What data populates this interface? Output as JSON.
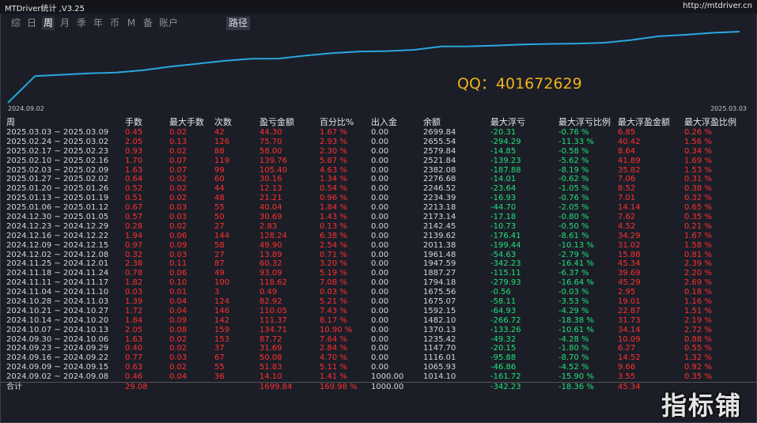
{
  "window": {
    "title": "MTDriver统计 ,V3.25",
    "link": "http://mtdriver.cn"
  },
  "tabs": [
    {
      "label": "综",
      "active": false
    },
    {
      "label": "日",
      "active": false
    },
    {
      "label": "周",
      "active": true
    },
    {
      "label": "月",
      "active": false
    },
    {
      "label": "季",
      "active": false
    },
    {
      "label": "年",
      "active": false
    },
    {
      "label": "币",
      "active": false
    },
    {
      "label": "M",
      "active": false
    },
    {
      "label": "备",
      "active": false
    },
    {
      "label": "账户",
      "active": false
    }
  ],
  "path_button": "路径",
  "chart": {
    "overlay_text": "QQ：401672629",
    "x_start_label": "2024.09.02",
    "x_end_label": "2025.03.03",
    "line_color": "#2aa7e0"
  },
  "columns": [
    "周",
    "手数",
    "最大手数",
    "次数",
    "盈亏金额",
    "百分比%",
    "出入金",
    "余额",
    "最大浮亏",
    "最大浮亏比例",
    "最大浮盈金额",
    "最大浮盈比例"
  ],
  "rows": [
    [
      "2025.03.03 ~ 2025.03.09",
      "0.45",
      "0.02",
      "42",
      "44.30",
      "1.67 %",
      "0.00",
      "2699.84",
      "-20.31",
      "-0.76 %",
      "6.85",
      "0.26 %"
    ],
    [
      "2025.02.24 ~ 2025.03.02",
      "2.05",
      "0.13",
      "126",
      "75.70",
      "2.93 %",
      "0.00",
      "2655.54",
      "-294.29",
      "-11.33 %",
      "40.42",
      "1.56 %"
    ],
    [
      "2025.02.17 ~ 2025.02.23",
      "0.93",
      "0.02",
      "88",
      "58.00",
      "2.30 %",
      "0.00",
      "2579.84",
      "-14.85",
      "-0.58 %",
      "8.64",
      "0.34 %"
    ],
    [
      "2025.02.10 ~ 2025.02.16",
      "1.70",
      "0.07",
      "119",
      "139.76",
      "5.87 %",
      "0.00",
      "2521.84",
      "-139.23",
      "-5.62 %",
      "41.89",
      "1.69 %"
    ],
    [
      "2025.02.03 ~ 2025.02.09",
      "1.63",
      "0.07",
      "99",
      "105.40",
      "4.63 %",
      "0.00",
      "2382.08",
      "-187.88",
      "-8.19 %",
      "35.82",
      "1.53 %"
    ],
    [
      "2025.01.27 ~ 2025.02.02",
      "0.64",
      "0.02",
      "60",
      "30.16",
      "1.34 %",
      "0.00",
      "2276.68",
      "-14.01",
      "-0.62 %",
      "7.06",
      "0.31 %"
    ],
    [
      "2025.01.20 ~ 2025.01.26",
      "0.52",
      "0.02",
      "44",
      "12.13",
      "0.54 %",
      "0.00",
      "2246.52",
      "-23.64",
      "-1.05 %",
      "8.52",
      "0.38 %"
    ],
    [
      "2025.01.13 ~ 2025.01.19",
      "0.51",
      "0.02",
      "48",
      "21.21",
      "0.96 %",
      "0.00",
      "2234.39",
      "-16.93",
      "-0.76 %",
      "7.01",
      "0.32 %"
    ],
    [
      "2025.01.06 ~ 2025.01.12",
      "0.67",
      "0.03",
      "55",
      "40.04",
      "1.84 %",
      "0.00",
      "2213.18",
      "-44.70",
      "-2.05 %",
      "14.14",
      "0.65 %"
    ],
    [
      "2024.12.30 ~ 2025.01.05",
      "0.57",
      "0.03",
      "50",
      "30.69",
      "1.43 %",
      "0.00",
      "2173.14",
      "-17.18",
      "-0.80 %",
      "7.62",
      "0.35 %"
    ],
    [
      "2024.12.23 ~ 2024.12.29",
      "0.28",
      "0.02",
      "27",
      "2.83",
      "0.13 %",
      "0.00",
      "2142.45",
      "-10.73",
      "-0.50 %",
      "4.52",
      "0.21 %"
    ],
    [
      "2024.12.16 ~ 2024.12.22",
      "1.94",
      "0.06",
      "144",
      "128.24",
      "6.38 %",
      "0.00",
      "2139.62",
      "-176.41",
      "-8.61 %",
      "34.29",
      "1.67 %"
    ],
    [
      "2024.12.09 ~ 2024.12.15",
      "0.97",
      "0.09",
      "58",
      "49.90",
      "2.54 %",
      "0.00",
      "2011.38",
      "-199.44",
      "-10.13 %",
      "31.02",
      "1.58 %"
    ],
    [
      "2024.12.02 ~ 2024.12.08",
      "0.32",
      "0.03",
      "27",
      "13.89",
      "0.71 %",
      "0.00",
      "1961.48",
      "-54.63",
      "-2.79 %",
      "15.88",
      "0.81 %"
    ],
    [
      "2024.11.25 ~ 2024.12.01",
      "2.38",
      "0.11",
      "87",
      "60.32",
      "3.20 %",
      "0.00",
      "1947.59",
      "-342.23",
      "-16.41 %",
      "45.34",
      "2.39 %"
    ],
    [
      "2024.11.18 ~ 2024.11.24",
      "0.78",
      "0.06",
      "49",
      "93.09",
      "5.19 %",
      "0.00",
      "1887.27",
      "-115.11",
      "-6.37 %",
      "39.69",
      "2.20 %"
    ],
    [
      "2024.11.11 ~ 2024.11.17",
      "1.82",
      "0.10",
      "100",
      "118.62",
      "7.08 %",
      "0.00",
      "1794.18",
      "-279.93",
      "-16.64 %",
      "45.29",
      "2.69 %"
    ],
    [
      "2024.11.04 ~ 2024.11.10",
      "0.03",
      "0.01",
      "3",
      "0.49",
      "0.03 %",
      "0.00",
      "1675.56",
      "-0.56",
      "-0.03 %",
      "2.95",
      "0.18 %"
    ],
    [
      "2024.10.28 ~ 2024.11.03",
      "1.39",
      "0.04",
      "124",
      "82.92",
      "5.21 %",
      "0.00",
      "1675.07",
      "-58.11",
      "-3.53 %",
      "19.01",
      "1.16 %"
    ],
    [
      "2024.10.21 ~ 2024.10.27",
      "1.72",
      "0.04",
      "146",
      "110.05",
      "7.43 %",
      "0.00",
      "1592.15",
      "-64.93",
      "-4.29 %",
      "22.87",
      "1.51 %"
    ],
    [
      "2024.10.14 ~ 2024.10.20",
      "1.84",
      "0.09",
      "142",
      "111.37",
      "8.17 %",
      "0.00",
      "1482.10",
      "-266.72",
      "-18.38 %",
      "31.73",
      "2.19 %"
    ],
    [
      "2024.10.07 ~ 2024.10.13",
      "2.05",
      "0.08",
      "159",
      "134.71",
      "10.90 %",
      "0.00",
      "1370.13",
      "-133.26",
      "-10.61 %",
      "34.14",
      "2.72 %"
    ],
    [
      "2024.09.30 ~ 2024.10.06",
      "1.63",
      "0.02",
      "153",
      "87.72",
      "7.64 %",
      "0.00",
      "1235.42",
      "-49.32",
      "-4.28 %",
      "10.09",
      "0.88 %"
    ],
    [
      "2024.09.23 ~ 2024.09.29",
      "0.40",
      "0.02",
      "37",
      "31.69",
      "2.84 %",
      "0.00",
      "1147.70",
      "-20.15",
      "-1.80 %",
      "6.27",
      "0.55 %"
    ],
    [
      "2024.09.16 ~ 2024.09.22",
      "0.77",
      "0.03",
      "67",
      "50.08",
      "4.70 %",
      "0.00",
      "1116.01",
      "-95.88",
      "-8.70 %",
      "14.52",
      "1.32 %"
    ],
    [
      "2024.09.09 ~ 2024.09.15",
      "0.63",
      "0.02",
      "55",
      "51.83",
      "5.11 %",
      "0.00",
      "1065.93",
      "-46.86",
      "-4.52 %",
      "9.66",
      "0.92 %"
    ],
    [
      "2024.09.02 ~ 2024.09.08",
      "0.46",
      "0.04",
      "36",
      "14.10",
      "1.41 %",
      "1000.00",
      "1014.10",
      "-161.72",
      "-15.90 %",
      "3.55",
      "0.35 %"
    ]
  ],
  "total_row": [
    "合计",
    "29.08",
    "",
    "",
    "1699.84",
    "169.98 %",
    "1000.00",
    "",
    "-342.23",
    "-18.36 %",
    "45.34",
    ""
  ],
  "watermark": "指标铺",
  "colors": {
    "background": "#1b1e27",
    "positive": "#ff3030",
    "negative": "#22e07a",
    "neutral": "#d6d6d6",
    "accent": "#f0b21a"
  }
}
